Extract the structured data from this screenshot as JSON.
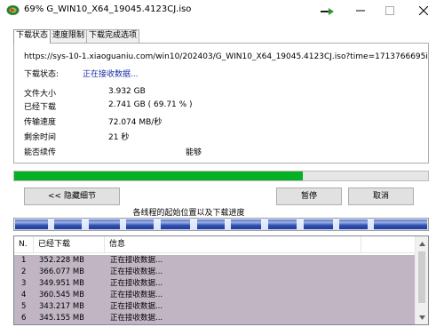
{
  "window": {
    "title": "69% G_WIN10_X64_19045.4123CJ.iso",
    "minimize_icon": "minimize-icon",
    "maximize_icon": "maximize-icon",
    "close_icon": "close-icon"
  },
  "tabs": [
    {
      "label": "下载状态",
      "active": true
    },
    {
      "label": "速度限制",
      "active": false
    },
    {
      "label": "下载完成选项",
      "active": false
    }
  ],
  "status": {
    "url": "https://sys-10-1.xiaoguaniu.com/win10/202403/G_WIN10_X64_19045.4123CJ.iso?time=1713766695i",
    "status_label": "下载状态:",
    "status_value": "正在接收数据...",
    "file_size_label": "文件大小",
    "file_size_value": "3.932  GB",
    "downloaded_label": "已经下载",
    "downloaded_value": "2.741  GB  ( 69.71 % )",
    "speed_label": "传输速度",
    "speed_value": "72.074  MB/秒",
    "remaining_label": "剩余时间",
    "remaining_value": "21 秒",
    "resume_label": "能否续传",
    "resume_value": "能够"
  },
  "progress": {
    "fraction": 0.6971,
    "color": "#06b025"
  },
  "buttons": {
    "hide_details": "<< 隐藏细节",
    "pause": "暂停",
    "cancel": "取消"
  },
  "threads": {
    "caption": "各线程的起始位置以及下载进度"
  },
  "list": {
    "columns": [
      "N.",
      "已经下载",
      "信息"
    ],
    "rows": [
      {
        "n": "1",
        "downloaded": "352.228 MB",
        "info": "正在接收数据..."
      },
      {
        "n": "2",
        "downloaded": "366.077 MB",
        "info": "正在接收数据..."
      },
      {
        "n": "3",
        "downloaded": "349.951 MB",
        "info": "正在接收数据..."
      },
      {
        "n": "4",
        "downloaded": "360.545 MB",
        "info": "正在接收数据..."
      },
      {
        "n": "5",
        "downloaded": "343.217 MB",
        "info": "正在接收数据..."
      },
      {
        "n": "6",
        "downloaded": "345.155 MB",
        "info": "正在接收数据..."
      }
    ],
    "row_color": "#c1b5c4"
  }
}
